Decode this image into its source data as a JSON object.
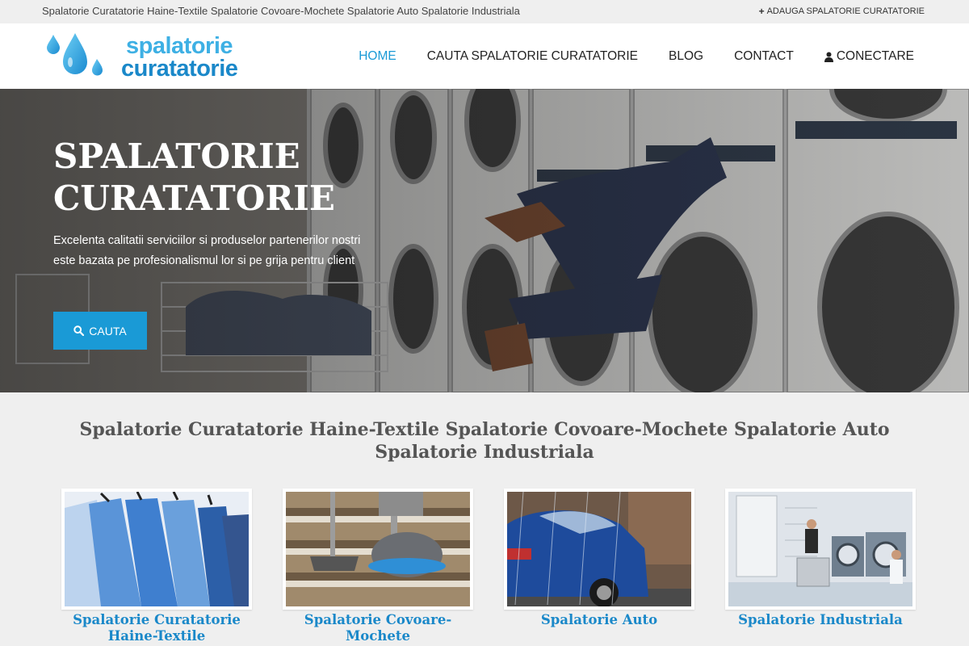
{
  "topbar": {
    "categories_text": "Spalatorie Curatatorie Haine-Textile Spalatorie Covoare-Mochete Spalatorie Auto Spalatorie Industriala",
    "add_label": "ADAUGA SPALATORIE CURATATORIE",
    "add_icon": "plus-icon"
  },
  "header": {
    "logo": {
      "line1": "spalatorie",
      "line2": "curatatorie",
      "icon": "water-drops-icon"
    },
    "nav": [
      {
        "label": "HOME",
        "active": true
      },
      {
        "label": "CAUTA SPALATORIE CURATATORIE",
        "active": false
      },
      {
        "label": "BLOG",
        "active": false
      },
      {
        "label": "CONTACT",
        "active": false
      },
      {
        "label": "CONECTARE",
        "active": false,
        "icon": "user-icon"
      }
    ]
  },
  "hero": {
    "title": "SPALATORIE CURATATORIE",
    "description": "Excelenta calitatii serviciilor si produselor partenerilor nostri este bazata pe profesionalismul lor si pe grija pentru client",
    "button_label": "CAUTA",
    "button_icon": "search-icon"
  },
  "section": {
    "title": "Spalatorie Curatatorie Haine-Textile Spalatorie Covoare-Mochete Spalatorie Auto Spalatorie Industriala",
    "cards": [
      {
        "label": "Spalatorie Curatatorie Haine-Textile",
        "image": "shirts-on-hangers"
      },
      {
        "label": "Spalatorie Covoare-Mochete",
        "image": "carpet-cleaning-machine"
      },
      {
        "label": "Spalatorie Auto",
        "image": "car-wash"
      },
      {
        "label": "Spalatorie Industriala",
        "image": "industrial-laundry"
      }
    ]
  },
  "colors": {
    "accent": "#1a9ad6",
    "logo_light": "#3eb0e4",
    "logo_dark": "#1a88c9",
    "page_bg": "#efefef"
  }
}
